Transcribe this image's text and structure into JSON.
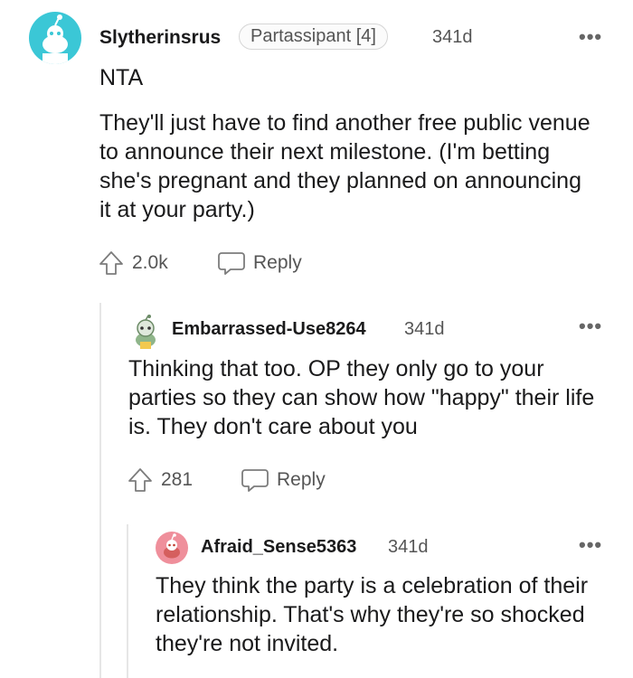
{
  "comments": [
    {
      "username": "Slytherinsrus",
      "flair": "Partassipant [4]",
      "timestamp": "341d",
      "text_short": "NTA",
      "text": "They'll just have to find another free public venue to announce their next milestone. (I'm betting she's pregnant and they planned on announcing it at your party.)",
      "score": "2.0k",
      "reply_label": "Reply",
      "more_label": "•••",
      "avatar_color": "#3bc7d6"
    },
    {
      "username": "Embarrassed-Use8264",
      "timestamp": "341d",
      "text": "Thinking that too. OP they only go to your parties so they can show how \"happy\" their life is. They don't care about you",
      "score": "281",
      "reply_label": "Reply",
      "more_label": "•••",
      "avatar_color": "#8fb58a"
    },
    {
      "username": "Afraid_Sense5363",
      "timestamp": "341d",
      "text": "They think the party is a celebration of their relationship. That's why they're so shocked they're not invited.",
      "more_label": "•••",
      "avatar_color": "#ef8f9b"
    }
  ]
}
